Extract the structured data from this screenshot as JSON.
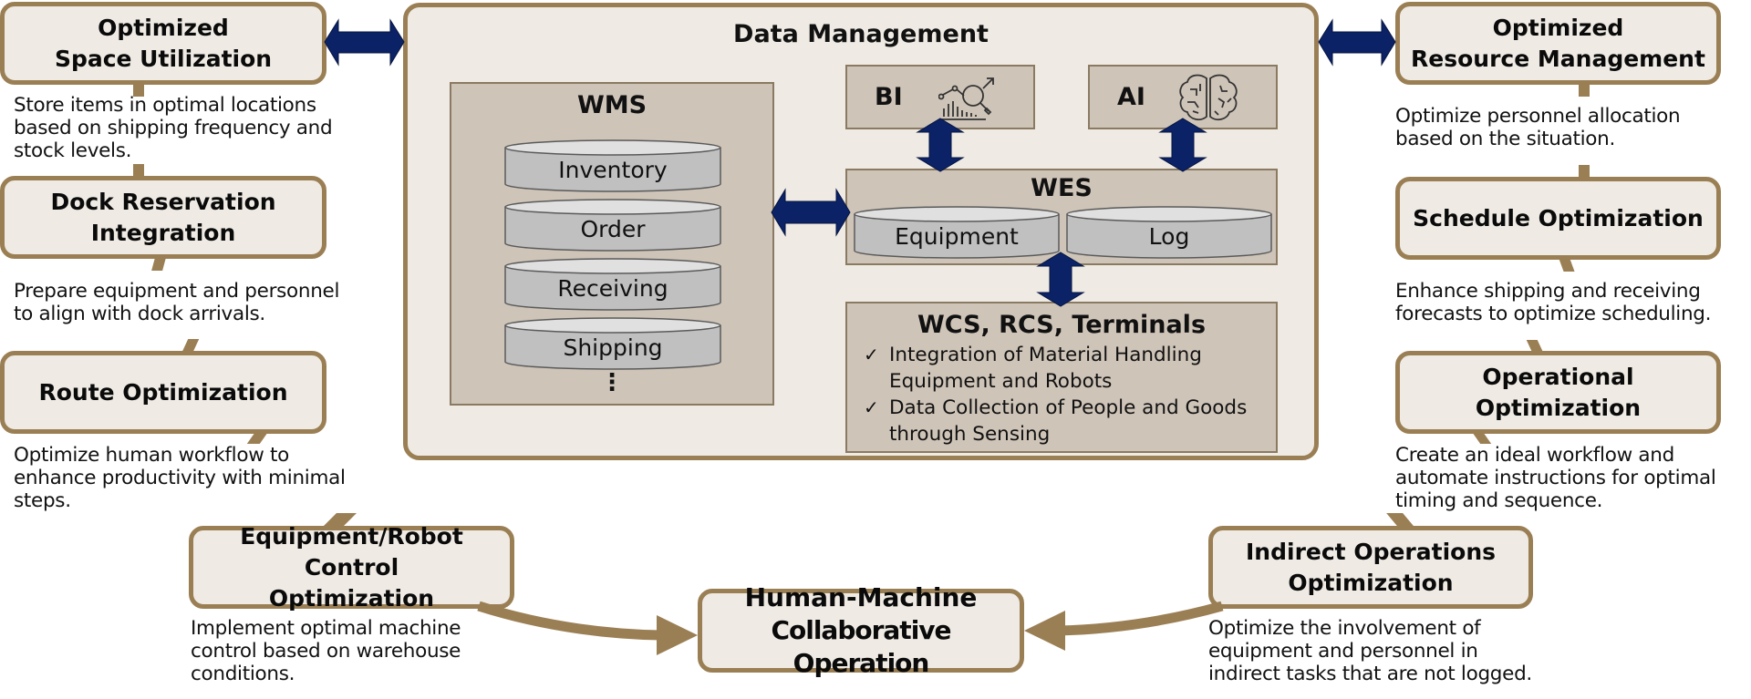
{
  "colors": {
    "box_fill": "#efebe4",
    "box_border": "#9b7f54",
    "panel_fill": "#cec4b8",
    "cylinder_fill": "#c0c0c0",
    "arrow_navy": "#0b2266",
    "arrow_tan": "#9b7f54"
  },
  "central": {
    "title": "Data Management",
    "wms": {
      "title": "WMS",
      "databases": [
        "Inventory",
        "Order",
        "Receiving",
        "Shipping"
      ],
      "more": "⋮"
    },
    "bi": {
      "label": "BI",
      "icon": "analytics-magnifier-icon"
    },
    "ai": {
      "label": "AI",
      "icon": "brain-icon"
    },
    "wes": {
      "title": "WES",
      "databases": [
        "Equipment",
        "Log"
      ]
    },
    "wcs": {
      "title": "WCS, RCS, Terminals",
      "items": [
        {
          "check": "✓",
          "text": "Integration of Material Handling Equipment and Robots"
        },
        {
          "check": "✓",
          "text": "Data Collection of People and Goods through Sensing"
        }
      ]
    }
  },
  "left": [
    {
      "title_line1": "Optimized",
      "title_line2": "Space Utilization",
      "desc": [
        "Store items in optimal locations",
        "based on shipping frequency and",
        "stock levels."
      ]
    },
    {
      "title_line1": "Dock Reservation",
      "title_line2": "Integration",
      "desc": [
        "Prepare equipment and personnel",
        "to align with dock arrivals."
      ]
    },
    {
      "title_line1": "Route Optimization",
      "title_line2": "",
      "desc": [
        "Optimize human workflow to",
        "enhance productivity with minimal",
        "steps."
      ]
    }
  ],
  "right": [
    {
      "title_line1": "Optimized",
      "title_line2": "Resource Management",
      "desc": [
        "Optimize personnel allocation",
        "based on the situation."
      ]
    },
    {
      "title_line1": "Schedule Optimization",
      "title_line2": "",
      "desc": [
        "Enhance shipping and receiving",
        "forecasts to optimize scheduling."
      ]
    },
    {
      "title_line1": "Operational",
      "title_line2": "Optimization",
      "desc": [
        "Create an ideal workflow and",
        "automate instructions for optimal",
        "timing and sequence."
      ]
    }
  ],
  "bottom": {
    "equipment_robot": {
      "title_line1": "Equipment/Robot Control",
      "title_line2": "Optimization",
      "desc": [
        "Implement optimal machine",
        "control based on warehouse",
        "conditions."
      ]
    },
    "center": {
      "title_line1": "Human-Machine",
      "title_line2": "Collaborative Operation"
    },
    "indirect": {
      "title_line1": "Indirect Operations",
      "title_line2": "Optimization",
      "desc": [
        "Optimize the involvement of",
        "equipment and personnel in",
        "indirect tasks that are not logged."
      ]
    }
  }
}
